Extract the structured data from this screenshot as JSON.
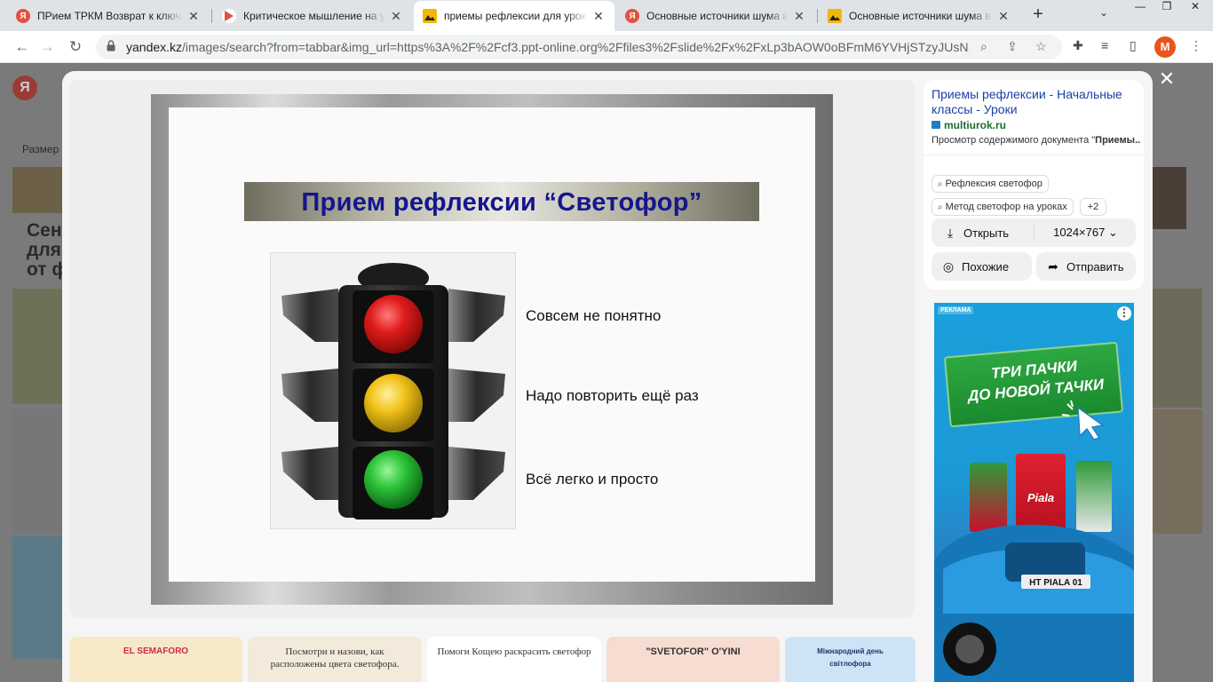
{
  "browser": {
    "tabs": [
      {
        "title": "ПРием ТРКМ Возврат к ключевы",
        "favicon": "yandex",
        "active": false
      },
      {
        "title": "Критическое мышление на урок",
        "favicon": "ppt-red",
        "active": false
      },
      {
        "title": "приемы рефлексии для уроков с",
        "favicon": "images",
        "active": true
      },
      {
        "title": "Основные источники шума в окр",
        "favicon": "yandex",
        "active": false
      },
      {
        "title": "Основные источники шума в окр",
        "favicon": "images",
        "active": false
      }
    ],
    "url_domain": "yandex.kz",
    "url_rest": "/images/search?from=tabbar&img_url=https%3A%2F%2Fcf3.ppt-online.org%2Ffiles3%2Fslide%2Fx%2FxLp3bAOW0oBFmM6YVHjSTzyJUsN...",
    "profile_initial": "M"
  },
  "background": {
    "logo": "Я",
    "size_filter": "Размер",
    "title_lines": [
      "Сенс",
      "для д",
      "от ф"
    ]
  },
  "slide": {
    "title": "Прием рефлексии “Светофор”",
    "items": [
      {
        "text": "Совсем не понятно",
        "color": "#e01c1c"
      },
      {
        "text": "Надо повторить ещё раз",
        "color": "#f2c31a"
      },
      {
        "text": "Всё легко и просто",
        "color": "#2ec43a"
      }
    ]
  },
  "panel": {
    "title": "Приемы рефлексии - Начальные классы - Уроки",
    "source": "multiurok.ru",
    "description_prefix": "Просмотр содержимого документа \"",
    "description_bold": "Приемы...",
    "chips": [
      "Рефлексия светофор",
      "Метод светофор на уроках",
      "+2"
    ],
    "open_label": "Открыть",
    "resolution": "1024×767",
    "similar_label": "Похожие",
    "share_label": "Отправить"
  },
  "ad": {
    "label": "РЕКЛАМА",
    "headline_1": "ТРИ ПАЧКИ",
    "headline_2": "ДО НОВОЙ ТАЧКИ",
    "plate": "НТ PIALA 01",
    "brand": "Piala"
  },
  "thumbnails": [
    {
      "text": "EL SEMAFORO"
    },
    {
      "text": "Посмотри и назови, как расположены цвета светофора."
    },
    {
      "text": "Помоги Кощею раскрасить светофор"
    },
    {
      "text": "\"SVETOFOR\" O'YINI"
    },
    {
      "text": "Міжнародний день світлофора"
    }
  ]
}
